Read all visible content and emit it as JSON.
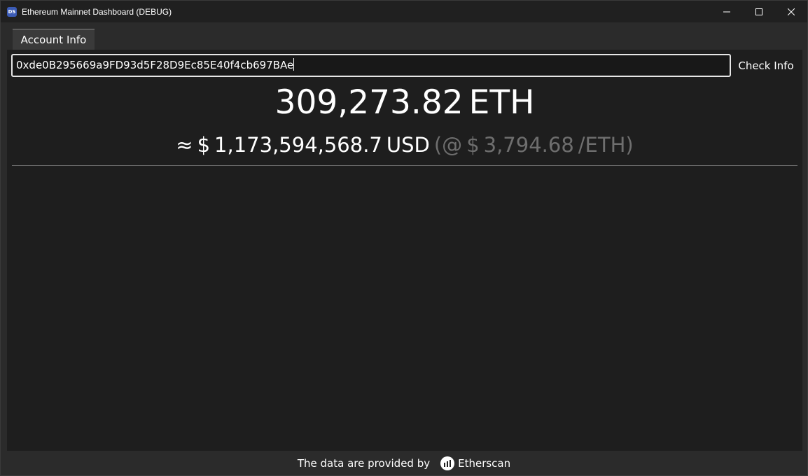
{
  "window": {
    "title": "Ethereum Mainnet Dashboard (DEBUG)",
    "app_icon_label": "DS"
  },
  "tabs": [
    {
      "label": "Account Info",
      "active": true
    }
  ],
  "account": {
    "address": "0xde0B295669a9FD93d5F28D9Ec85E40f4cb697BAe",
    "check_label": "Check Info"
  },
  "balance": {
    "eth_value": "309,273.82",
    "eth_unit": "ETH",
    "approx_symbol": "≈",
    "usd_symbol": "$",
    "usd_value": "1,173,594,568.7",
    "usd_unit": "USD",
    "rate_prefix": "(@",
    "rate_symbol": "$",
    "rate_value": "3,794.68",
    "rate_suffix": "/ETH)"
  },
  "footer": {
    "text": "The data are provided by",
    "provider": "Etherscan"
  },
  "colors": {
    "background": "#1e1e1e",
    "muted_text": "#6e6e6e",
    "input_border": "#e6e6e6"
  }
}
